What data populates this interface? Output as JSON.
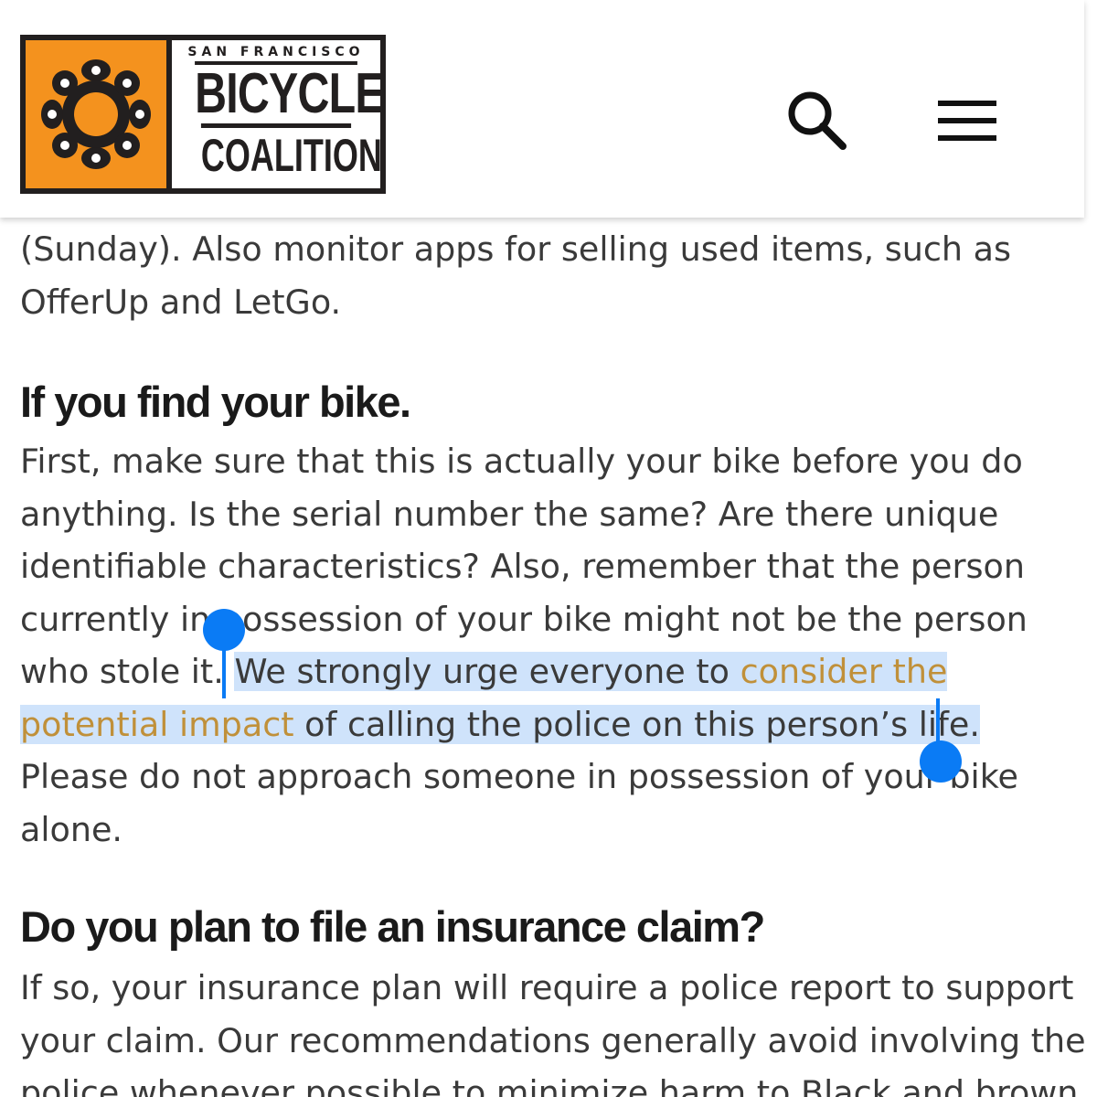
{
  "header": {
    "logo": {
      "top_line": "SAN FRANCISCO",
      "word1": "BICYCLE",
      "word2": "COALITION",
      "alt": "San Francisco Bicycle Coalition"
    },
    "search_icon": "search-icon",
    "menu_icon": "hamburger-menu-icon"
  },
  "article": {
    "intro_lines": [
      "(Sunday). Also monitor apps for selling used items, such as",
      "OfferUp and LetGo."
    ],
    "section1": {
      "heading": "If you find your bike.",
      "lines": [
        "First, make sure that this is actually your bike before you do",
        "anything. Is the serial number the same? Are there unique",
        "identifiable characteristics? Also, remember that the person",
        "currently in possession of your bike might not be the person"
      ],
      "line5_pre": "who stole it. ",
      "line5_sel": "We strongly urge everyone to ",
      "link_part1": "consider the",
      "link_part2": "potential impact",
      "line6_sel": " of calling the police on this person’s life.",
      "line7": "Please do not approach someone in possession of your bike",
      "line8": "alone."
    },
    "section2": {
      "heading": "Do you plan to file an insurance claim?",
      "lines": [
        "If so, your insurance plan will require a police report to support",
        "your claim. Our recommendations generally avoid involving the",
        "police whenever possible to minimize harm to Black and brown"
      ]
    }
  },
  "colors": {
    "brand_orange": "#f4921e",
    "link": "#c0903a",
    "selection": "#cfe3fb",
    "handle": "#0a7bf5",
    "body_text": "#3a3a3a"
  }
}
